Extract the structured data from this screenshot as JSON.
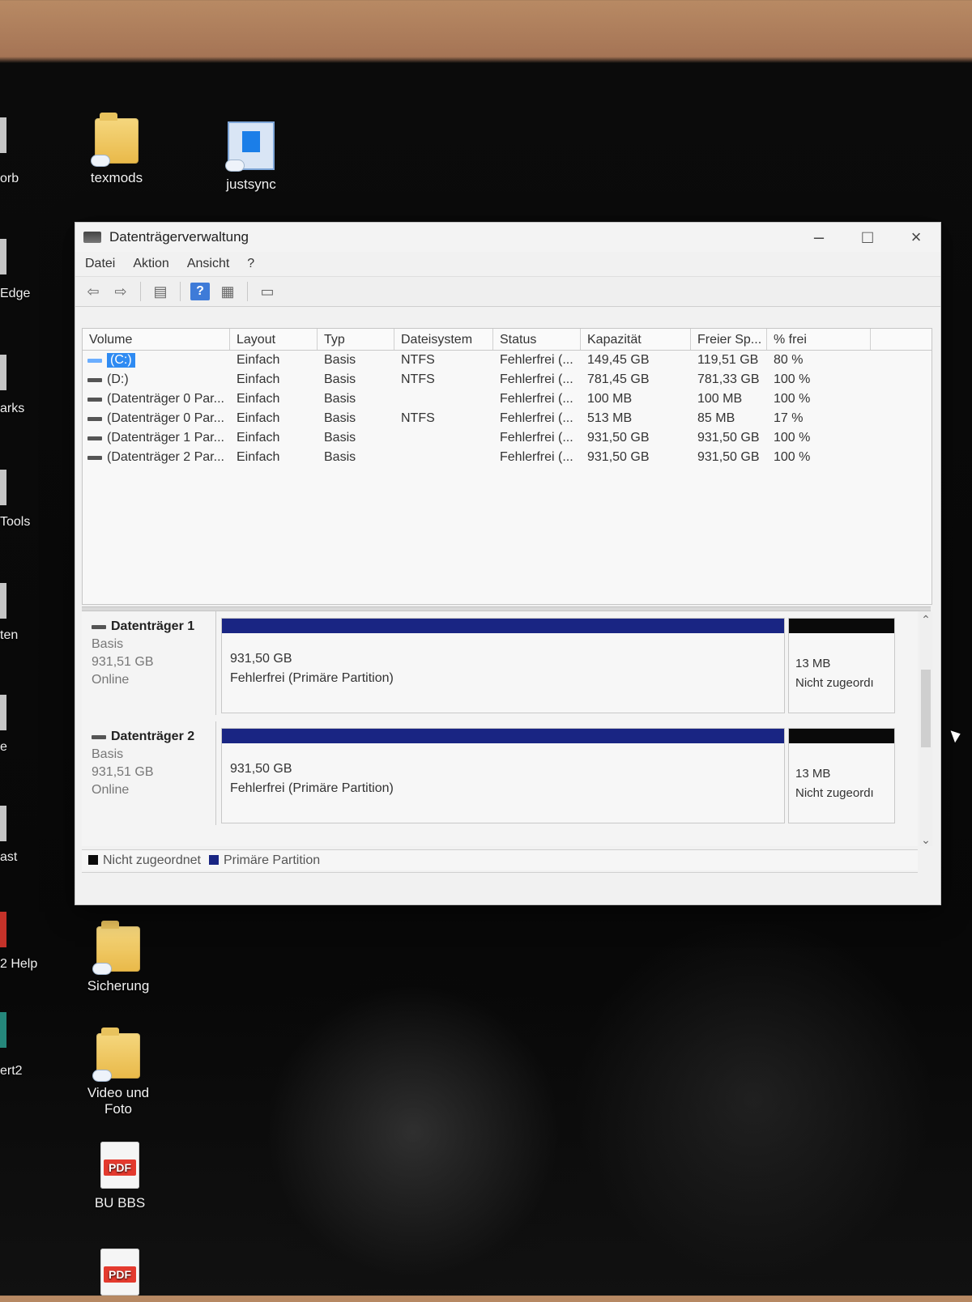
{
  "desktop": {
    "left_partial_labels": [
      "orb",
      "Edge",
      "arks",
      "Tools",
      "ten",
      "e",
      "ast",
      "2 Help",
      "ert2"
    ],
    "icons": [
      {
        "label": "texmods",
        "icon": "folder-cloud-icon"
      },
      {
        "label": "justsync",
        "icon": "app-window-icon"
      },
      {
        "label": "Sicherung",
        "icon": "folder-cloud-icon"
      },
      {
        "label": "Video und Foto",
        "icon": "folder-cloud-icon"
      },
      {
        "label": "BU BBS",
        "icon": "pdf-file-icon",
        "badge": "PDF"
      },
      {
        "label": "",
        "icon": "pdf-file-icon",
        "badge": "PDF"
      }
    ]
  },
  "window": {
    "title": "Datenträgerverwaltung",
    "menu": [
      "Datei",
      "Aktion",
      "Ansicht",
      "?"
    ],
    "toolbar_icons": [
      "back-arrow-icon",
      "forward-arrow-icon",
      "disk-list-icon",
      "help-icon",
      "properties-icon",
      "console-icon"
    ],
    "volume_table": {
      "columns": [
        "Volume",
        "Layout",
        "Typ",
        "Dateisystem",
        "Status",
        "Kapazität",
        "Freier Sp...",
        "% frei"
      ],
      "rows": [
        [
          "(C:)",
          "Einfach",
          "Basis",
          "NTFS",
          "Fehlerfrei (...",
          "149,45 GB",
          "119,51 GB",
          "80 %"
        ],
        [
          "(D:)",
          "Einfach",
          "Basis",
          "NTFS",
          "Fehlerfrei (...",
          "781,45 GB",
          "781,33 GB",
          "100 %"
        ],
        [
          "(Datenträger 0 Par...",
          "Einfach",
          "Basis",
          "",
          "Fehlerfrei (...",
          "100 MB",
          "100 MB",
          "100 %"
        ],
        [
          "(Datenträger 0 Par...",
          "Einfach",
          "Basis",
          "NTFS",
          "Fehlerfrei (...",
          "513 MB",
          "85 MB",
          "17 %"
        ],
        [
          "(Datenträger 1 Par...",
          "Einfach",
          "Basis",
          "",
          "Fehlerfrei (...",
          "931,50 GB",
          "931,50 GB",
          "100 %"
        ],
        [
          "(Datenträger 2 Par...",
          "Einfach",
          "Basis",
          "",
          "Fehlerfrei (...",
          "931,50 GB",
          "931,50 GB",
          "100 %"
        ]
      ]
    },
    "disks": [
      {
        "name": "Datenträger 1",
        "type": "Basis",
        "size": "931,51 GB",
        "status": "Online",
        "main_partition": {
          "size": "931,50 GB",
          "status": "Fehlerfrei (Primäre Partition)"
        },
        "unallocated": {
          "size": "13 MB",
          "label": "Nicht zugeordı"
        }
      },
      {
        "name": "Datenträger 2",
        "type": "Basis",
        "size": "931,51 GB",
        "status": "Online",
        "main_partition": {
          "size": "931,50 GB",
          "status": "Fehlerfrei (Primäre Partition)"
        },
        "unallocated": {
          "size": "13 MB",
          "label": "Nicht zugeordı"
        }
      }
    ],
    "legend": [
      {
        "label": "Nicht zugeordnet",
        "color": "#0a0a0a"
      },
      {
        "label": "Primäre Partition",
        "color": "#192583"
      }
    ]
  }
}
